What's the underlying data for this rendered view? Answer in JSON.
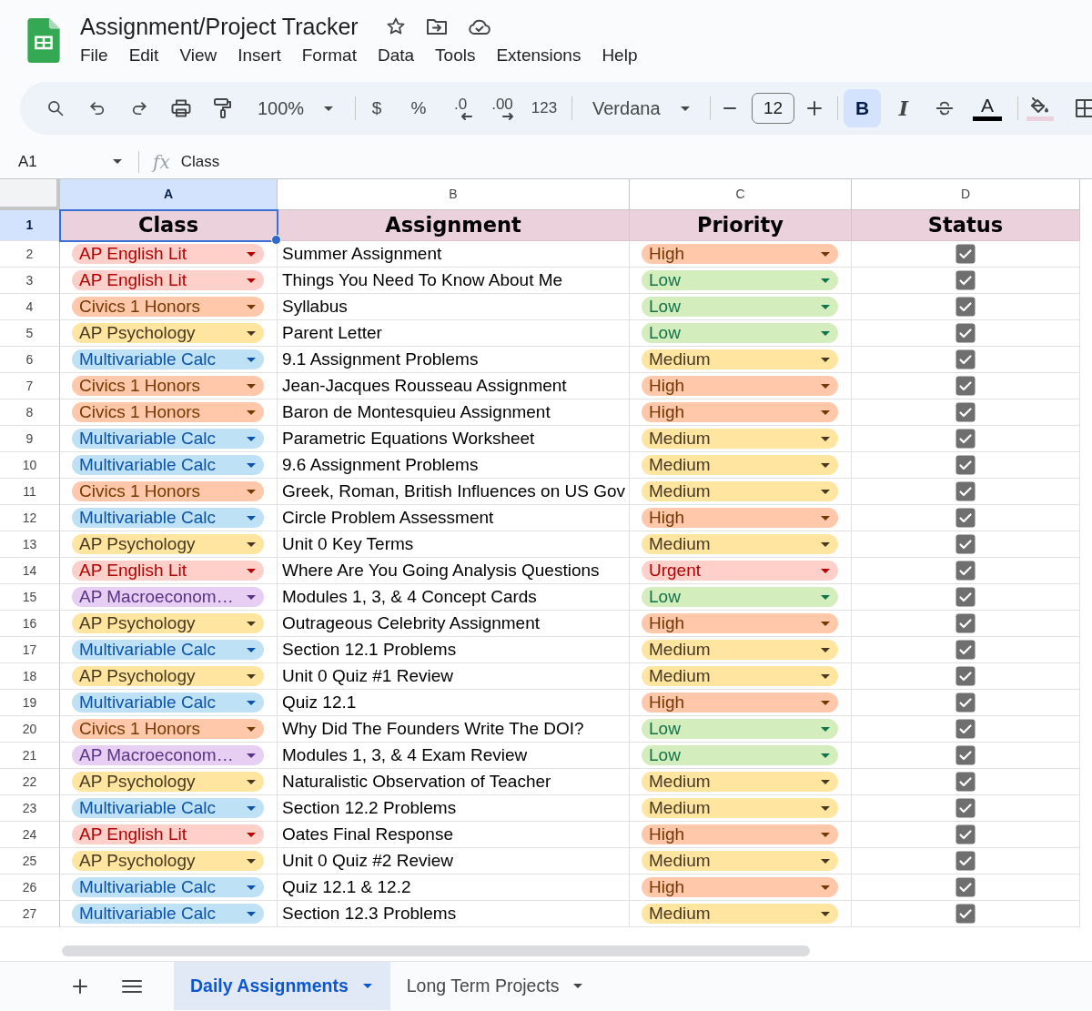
{
  "document": {
    "title": "Assignment/Project Tracker"
  },
  "menu": [
    "File",
    "Edit",
    "View",
    "Insert",
    "Format",
    "Data",
    "Tools",
    "Extensions",
    "Help"
  ],
  "toolbar": {
    "zoom": "100%",
    "currency": "$",
    "percent": "%",
    "decrease_decimal": ".0",
    "increase_decimal": ".00",
    "number_format": "123",
    "font": "Verdana",
    "font_size": "12",
    "bold": {
      "label": "B",
      "selected": true
    },
    "italic": {
      "label": "I",
      "selected": false
    },
    "text_color": "A"
  },
  "formula_bar": {
    "cell_ref": "A1",
    "fx": "fx",
    "formula": "Class"
  },
  "columns": [
    {
      "letter": "A",
      "selected": true
    },
    {
      "letter": "B",
      "selected": false
    },
    {
      "letter": "C",
      "selected": false
    },
    {
      "letter": "D",
      "selected": false
    }
  ],
  "header_row": {
    "number": "1",
    "selected": true,
    "cells": [
      "Class",
      "Assignment",
      "Priority",
      "Status"
    ]
  },
  "rows": [
    {
      "number": "2",
      "selected": false,
      "class": {
        "text": "AP English Lit",
        "color": "#ffcfc9"
      },
      "assignment": "Summer Assignment",
      "priority": {
        "text": "High",
        "color": "#ffc8aa"
      },
      "checked": true
    },
    {
      "number": "3",
      "selected": false,
      "class": {
        "text": "AP English Lit",
        "color": "#ffcfc9"
      },
      "assignment": "Things You Need To Know About Me",
      "priority": {
        "text": "Low",
        "color": "#d4edbc"
      },
      "checked": true
    },
    {
      "number": "4",
      "selected": false,
      "class": {
        "text": "Civics 1 Honors",
        "color": "#ffc8aa"
      },
      "assignment": "Syllabus",
      "priority": {
        "text": "Low",
        "color": "#d4edbc"
      },
      "checked": true
    },
    {
      "number": "5",
      "selected": false,
      "class": {
        "text": "AP Psychology",
        "color": "#ffe5a0"
      },
      "assignment": "Parent Letter",
      "priority": {
        "text": "Low",
        "color": "#d4edbc"
      },
      "checked": true
    },
    {
      "number": "6",
      "selected": false,
      "class": {
        "text": "Multivariable Calc",
        "color": "#bfe1f6"
      },
      "assignment": "9.1 Assignment Problems",
      "priority": {
        "text": "Medium",
        "color": "#ffe5a0"
      },
      "checked": true
    },
    {
      "number": "7",
      "selected": false,
      "class": {
        "text": "Civics 1 Honors",
        "color": "#ffc8aa"
      },
      "assignment": "Jean-Jacques Rousseau Assignment",
      "priority": {
        "text": "High",
        "color": "#ffc8aa"
      },
      "checked": true
    },
    {
      "number": "8",
      "selected": false,
      "class": {
        "text": "Civics 1 Honors",
        "color": "#ffc8aa"
      },
      "assignment": "Baron de Montesquieu Assignment",
      "priority": {
        "text": "High",
        "color": "#ffc8aa"
      },
      "checked": true
    },
    {
      "number": "9",
      "selected": false,
      "class": {
        "text": "Multivariable Calc",
        "color": "#bfe1f6"
      },
      "assignment": "Parametric Equations Worksheet",
      "priority": {
        "text": "Medium",
        "color": "#ffe5a0"
      },
      "checked": true
    },
    {
      "number": "10",
      "selected": false,
      "class": {
        "text": "Multivariable Calc",
        "color": "#bfe1f6"
      },
      "assignment": "9.6 Assignment Problems",
      "priority": {
        "text": "Medium",
        "color": "#ffe5a0"
      },
      "checked": true
    },
    {
      "number": "11",
      "selected": false,
      "class": {
        "text": "Civics 1 Honors",
        "color": "#ffc8aa"
      },
      "assignment": "Greek, Roman, British Influences on US Gov",
      "priority": {
        "text": "Medium",
        "color": "#ffe5a0"
      },
      "checked": true
    },
    {
      "number": "12",
      "selected": false,
      "class": {
        "text": "Multivariable Calc",
        "color": "#bfe1f6"
      },
      "assignment": "Circle Problem Assessment",
      "priority": {
        "text": "High",
        "color": "#ffc8aa"
      },
      "checked": true
    },
    {
      "number": "13",
      "selected": false,
      "class": {
        "text": "AP Psychology",
        "color": "#ffe5a0"
      },
      "assignment": "Unit 0 Key Terms",
      "priority": {
        "text": "Medium",
        "color": "#ffe5a0"
      },
      "checked": true
    },
    {
      "number": "14",
      "selected": false,
      "class": {
        "text": "AP English Lit",
        "color": "#ffcfc9"
      },
      "assignment": "Where Are You Going Analysis Questions",
      "priority": {
        "text": "Urgent",
        "color": "#ffcfc9"
      },
      "checked": true
    },
    {
      "number": "15",
      "selected": false,
      "class": {
        "text": "AP Macroeconom…",
        "color": "#e6cff2"
      },
      "assignment": "Modules 1, 3, & 4 Concept Cards",
      "priority": {
        "text": "Low",
        "color": "#d4edbc"
      },
      "checked": true
    },
    {
      "number": "16",
      "selected": false,
      "class": {
        "text": "AP Psychology",
        "color": "#ffe5a0"
      },
      "assignment": "Outrageous Celebrity Assignment",
      "priority": {
        "text": "High",
        "color": "#ffc8aa"
      },
      "checked": true
    },
    {
      "number": "17",
      "selected": false,
      "class": {
        "text": "Multivariable Calc",
        "color": "#bfe1f6"
      },
      "assignment": "Section 12.1 Problems",
      "priority": {
        "text": "Medium",
        "color": "#ffe5a0"
      },
      "checked": true
    },
    {
      "number": "18",
      "selected": false,
      "class": {
        "text": "AP Psychology",
        "color": "#ffe5a0"
      },
      "assignment": "Unit 0 Quiz #1 Review",
      "priority": {
        "text": "Medium",
        "color": "#ffe5a0"
      },
      "checked": true
    },
    {
      "number": "19",
      "selected": false,
      "class": {
        "text": "Multivariable Calc",
        "color": "#bfe1f6"
      },
      "assignment": "Quiz 12.1",
      "priority": {
        "text": "High",
        "color": "#ffc8aa"
      },
      "checked": true
    },
    {
      "number": "20",
      "selected": false,
      "class": {
        "text": "Civics 1 Honors",
        "color": "#ffc8aa"
      },
      "assignment": "Why Did The Founders Write The DOI?",
      "priority": {
        "text": "Low",
        "color": "#d4edbc"
      },
      "checked": true
    },
    {
      "number": "21",
      "selected": false,
      "class": {
        "text": "AP Macroeconom…",
        "color": "#e6cff2"
      },
      "assignment": "Modules 1, 3, & 4 Exam Review",
      "priority": {
        "text": "Low",
        "color": "#d4edbc"
      },
      "checked": true
    },
    {
      "number": "22",
      "selected": false,
      "class": {
        "text": "AP Psychology",
        "color": "#ffe5a0"
      },
      "assignment": "Naturalistic Observation of Teacher",
      "priority": {
        "text": "Medium",
        "color": "#ffe5a0"
      },
      "checked": true
    },
    {
      "number": "23",
      "selected": false,
      "class": {
        "text": "Multivariable Calc",
        "color": "#bfe1f6"
      },
      "assignment": "Section 12.2 Problems",
      "priority": {
        "text": "Medium",
        "color": "#ffe5a0"
      },
      "checked": true
    },
    {
      "number": "24",
      "selected": false,
      "class": {
        "text": "AP English Lit",
        "color": "#ffcfc9"
      },
      "assignment": "Oates Final Response",
      "priority": {
        "text": "High",
        "color": "#ffc8aa"
      },
      "checked": true
    },
    {
      "number": "25",
      "selected": false,
      "class": {
        "text": "AP Psychology",
        "color": "#ffe5a0"
      },
      "assignment": "Unit 0 Quiz #2 Review",
      "priority": {
        "text": "Medium",
        "color": "#ffe5a0"
      },
      "checked": true
    },
    {
      "number": "26",
      "selected": false,
      "class": {
        "text": "Multivariable Calc",
        "color": "#bfe1f6"
      },
      "assignment": "Quiz 12.1 & 12.2",
      "priority": {
        "text": "High",
        "color": "#ffc8aa"
      },
      "checked": true
    },
    {
      "number": "27",
      "selected": false,
      "class": {
        "text": "Multivariable Calc",
        "color": "#bfe1f6"
      },
      "assignment": "Section 12.3 Problems",
      "priority": {
        "text": "Medium",
        "color": "#ffe5a0"
      },
      "checked": true
    }
  ],
  "sheet_tabs": [
    {
      "label": "Daily Assignments",
      "selected": true
    },
    {
      "label": "Long Term Projects",
      "selected": false
    }
  ]
}
